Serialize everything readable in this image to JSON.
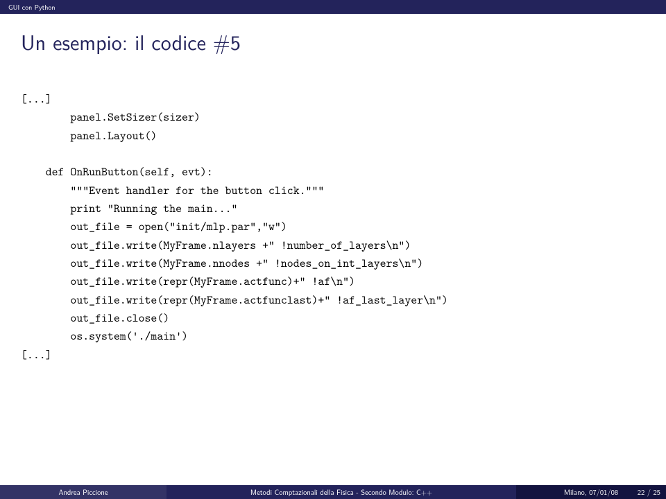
{
  "topbar": {
    "section": "GUI con Python"
  },
  "title": "Un esempio: il codice #5",
  "code": "[...]\n        panel.SetSizer(sizer)\n        panel.Layout()\n\n    def OnRunButton(self, evt):\n        \"\"\"Event handler for the button click.\"\"\"\n        print \"Running the main...\"\n        out_file = open(\"init/mlp.par\",\"w\")\n        out_file.write(MyFrame.nlayers +\" !number_of_layers\\n\")\n        out_file.write(MyFrame.nnodes +\" !nodes_on_int_layers\\n\")\n        out_file.write(repr(MyFrame.actfunc)+\" !af\\n\")\n        out_file.write(repr(MyFrame.actfunclast)+\" !af_last_layer\\n\")\n        out_file.close()\n        os.system('./main')\n[...]",
  "footer": {
    "author": "Andrea Piccione",
    "course": "Metodi Comptazionali della Fisica - Secondo Modulo: C++",
    "date": "Milano, 07/01/08",
    "page": "22 / 25"
  }
}
